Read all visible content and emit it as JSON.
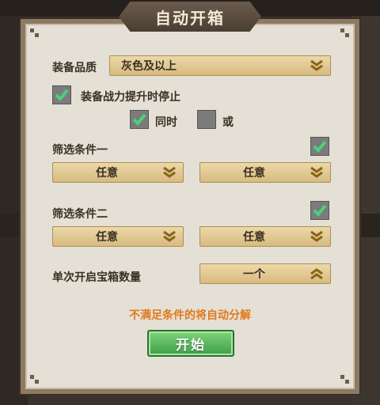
{
  "title": "自动开箱",
  "quality": {
    "label": "装备品质",
    "value": "灰色及以上"
  },
  "stop_on_power_up": {
    "label": "装备战力提升时停止",
    "checked": true
  },
  "logic": {
    "and_label": "同时",
    "and_checked": true,
    "or_label": "或",
    "or_checked": false
  },
  "filter1": {
    "label": "筛选条件一",
    "checked": true,
    "left_value": "任意",
    "right_value": "任意"
  },
  "filter2": {
    "label": "筛选条件二",
    "checked": true,
    "left_value": "任意",
    "right_value": "任意"
  },
  "open_count": {
    "label": "单次开启宝箱数量",
    "value": "一个"
  },
  "notice": "不满足条件的将自动分解",
  "start_button": "开始",
  "colors": {
    "accent": "#e07a1c",
    "button": "#4caf50",
    "check": "#4cd07a"
  },
  "icons": {
    "dropdown": "double-chevron-down-icon",
    "stepper": "double-chevron-up-icon",
    "check": "check-icon"
  }
}
